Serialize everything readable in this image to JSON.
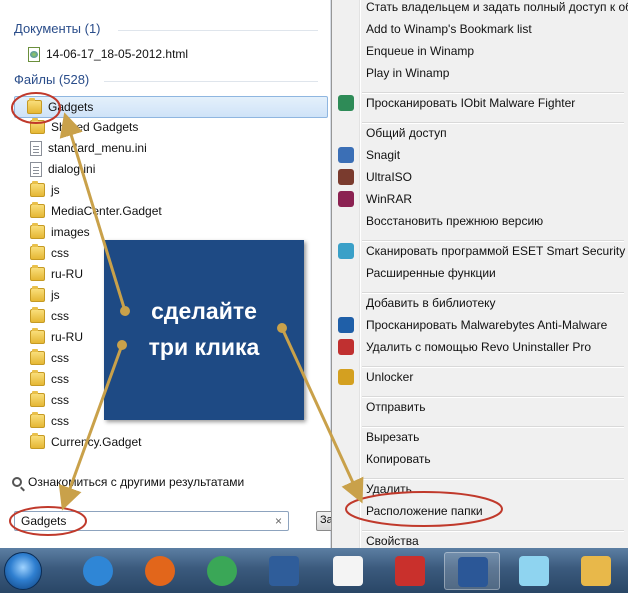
{
  "start_menu": {
    "documents_header": "Документы (1)",
    "documents": [
      {
        "label": "14-06-17_18-05-2012.html",
        "icon": "html-file-icon"
      }
    ],
    "files_header": "Файлы (528)",
    "files": [
      {
        "label": "Gadgets",
        "icon": "folder-icon",
        "selected": true
      },
      {
        "label": "Shared Gadgets",
        "icon": "folder-icon"
      },
      {
        "label": "standard_menu.ini",
        "icon": "ini-file-icon"
      },
      {
        "label": "dialog.ini",
        "icon": "ini-file-icon"
      },
      {
        "label": "js",
        "icon": "folder-icon"
      },
      {
        "label": "MediaCenter.Gadget",
        "icon": "folder-icon"
      },
      {
        "label": "images",
        "icon": "folder-icon"
      },
      {
        "label": "css",
        "icon": "folder-icon"
      },
      {
        "label": "ru-RU",
        "icon": "folder-icon"
      },
      {
        "label": "js",
        "icon": "folder-icon"
      },
      {
        "label": "css",
        "icon": "folder-icon"
      },
      {
        "label": "ru-RU",
        "icon": "folder-icon"
      },
      {
        "label": "css",
        "icon": "folder-icon"
      },
      {
        "label": "css",
        "icon": "folder-icon"
      },
      {
        "label": "css",
        "icon": "folder-icon"
      },
      {
        "label": "css",
        "icon": "folder-icon"
      },
      {
        "label": "Currency.Gadget",
        "icon": "folder-icon"
      }
    ],
    "more_results": "Ознакомиться с другими результатами",
    "search_value": "Gadgets",
    "search_clear": "×",
    "shutdown_label": "За"
  },
  "context_menu": {
    "items": [
      {
        "label": "Стать владельцем и задать полный доступ к объ"
      },
      {
        "label": "Add to Winamp's Bookmark list"
      },
      {
        "label": "Enqueue in Winamp"
      },
      {
        "label": "Play in Winamp"
      },
      {
        "separator": true
      },
      {
        "label": "Просканировать IObit Malware Fighter",
        "icon": "iobit-icon"
      },
      {
        "separator": true
      },
      {
        "label": "Общий доступ"
      },
      {
        "label": "Snagit",
        "icon": "snagit-icon"
      },
      {
        "label": "UltraISO",
        "icon": "ultraiso-icon"
      },
      {
        "label": "WinRAR",
        "icon": "winrar-icon"
      },
      {
        "label": "Восстановить прежнюю версию"
      },
      {
        "separator": true
      },
      {
        "label": "Сканировать программой ESET Smart Security",
        "icon": "eset-icon"
      },
      {
        "label": "Расширенные функции"
      },
      {
        "separator": true
      },
      {
        "label": "Добавить в библиотеку"
      },
      {
        "label": "Просканировать Malwarebytes Anti-Malware",
        "icon": "malwarebytes-icon"
      },
      {
        "label": "Удалить с помощью Revo Uninstaller Pro",
        "icon": "revo-icon"
      },
      {
        "separator": true
      },
      {
        "label": "Unlocker",
        "icon": "unlocker-icon"
      },
      {
        "separator": true
      },
      {
        "label": "Отправить"
      },
      {
        "separator": true
      },
      {
        "label": "Вырезать"
      },
      {
        "label": "Копировать"
      },
      {
        "separator": true
      },
      {
        "label": "Удалить"
      },
      {
        "label": "Расположение папки"
      },
      {
        "separator": true
      },
      {
        "label": "Свойства"
      }
    ]
  },
  "overlay": {
    "line1": "сделайте",
    "line2": "три клика"
  },
  "annotation_color": "#c9a14a",
  "highlight_color": "#c0392b",
  "taskbar": {
    "buttons": [
      {
        "name": "internet-explorer-icon",
        "color": "#2f86d6"
      },
      {
        "name": "firefox-icon",
        "color": "#e2661b"
      },
      {
        "name": "chrome-icon",
        "color": "#3aa757"
      },
      {
        "name": "app-icon",
        "color": "#2f5d9a"
      },
      {
        "name": "font-viewer-icon",
        "color": "#f4f4f4"
      },
      {
        "name": "magnifier-tool-icon",
        "color": "#c9302c"
      },
      {
        "name": "word-icon",
        "color": "#2b5797",
        "active": true
      },
      {
        "name": "notepad-icon",
        "color": "#8fd4f0"
      },
      {
        "name": "paint-icon",
        "color": "#e8b84a"
      }
    ]
  }
}
